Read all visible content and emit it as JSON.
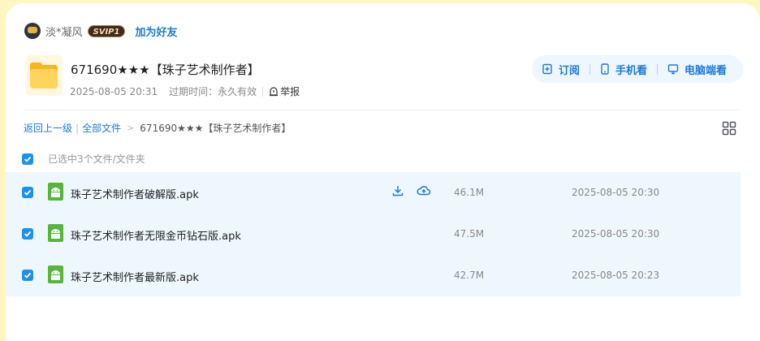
{
  "user": {
    "name": "淡*凝风",
    "badge": "SVIP1",
    "add_friend": "加为好友"
  },
  "folder": {
    "title": "671690★★★【珠子艺术制作者】",
    "date": "2025-08-05 20:31",
    "expire_label": "过期时间：",
    "expire_value": "永久有效",
    "report": "举报"
  },
  "actions": {
    "subscribe": "订阅",
    "mobile": "手机看",
    "pc": "电脑端看"
  },
  "breadcrumb": {
    "back": "返回上一级",
    "all": "全部文件",
    "current": "671690★★★【珠子艺术制作者】"
  },
  "selection": {
    "text": "已选中3个文件/文件夹"
  },
  "files": [
    {
      "name": "珠子艺术制作者破解版.apk",
      "size": "46.1M",
      "date": "2025-08-05 20:30",
      "checked": true
    },
    {
      "name": "珠子艺术制作者无限金币钻石版.apk",
      "size": "47.5M",
      "date": "2025-08-05 20:30",
      "checked": true
    },
    {
      "name": "珠子艺术制作者最新版.apk",
      "size": "42.7M",
      "date": "2025-08-05 20:23",
      "checked": true
    }
  ],
  "colors": {
    "accent": "#1e7ad8",
    "checkbox": "#1e90f0",
    "row_bg": "#eff7fe",
    "page_bg": "#fff6c2"
  }
}
